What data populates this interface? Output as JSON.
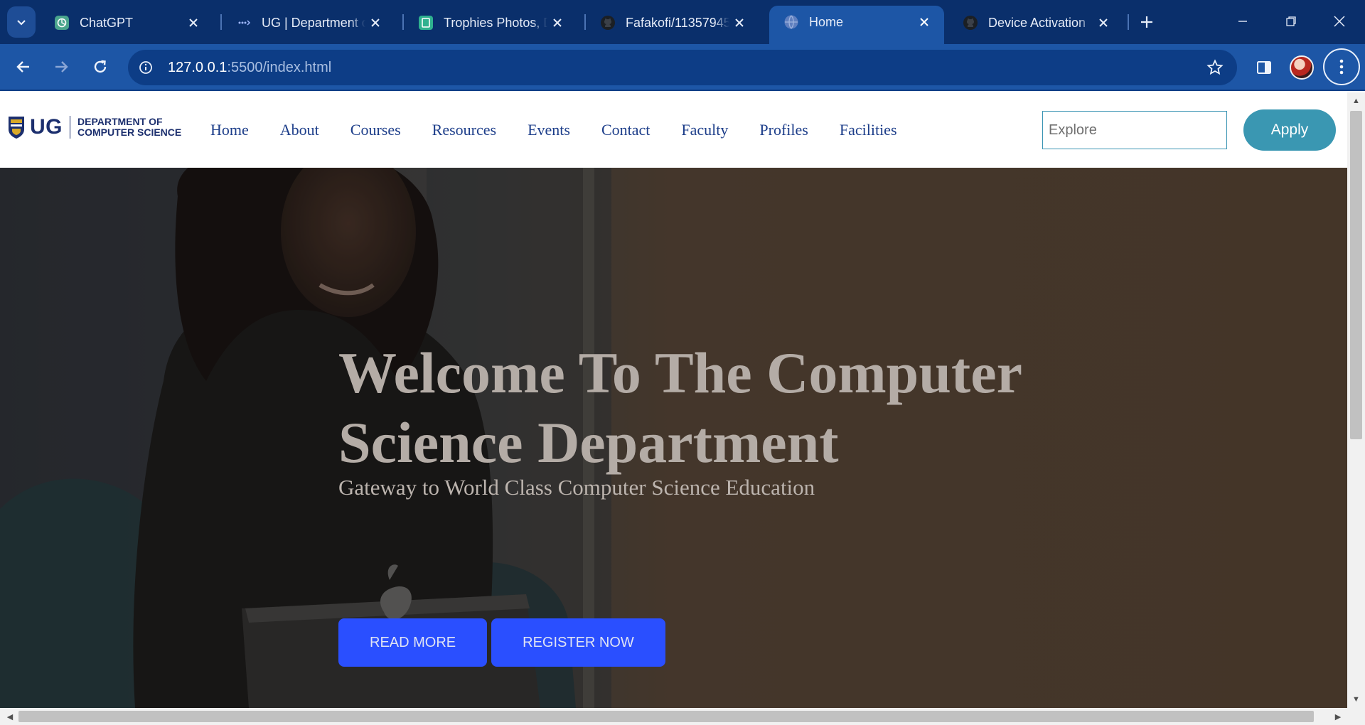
{
  "browser": {
    "tabs": [
      {
        "title": "ChatGPT",
        "icon": "chatgpt-icon",
        "active": false
      },
      {
        "title": "UG | Department of",
        "icon": "site-dots-icon",
        "active": false
      },
      {
        "title": "Trophies Photos, D",
        "icon": "photo-site-icon",
        "active": false
      },
      {
        "title": "Fafakofi/11357945",
        "icon": "github-icon",
        "active": false
      },
      {
        "title": "Home",
        "icon": "globe-icon",
        "active": true
      },
      {
        "title": "Device Activation",
        "icon": "github-icon",
        "active": false
      }
    ],
    "url_host": "127.0.0.1",
    "url_rest": ":5500/index.html"
  },
  "site": {
    "logo": {
      "short": "UG",
      "line1": "DEPARTMENT OF",
      "line2": "COMPUTER SCIENCE"
    },
    "nav": [
      "Home",
      "About",
      "Courses",
      "Resources",
      "Events",
      "Contact",
      "Faculty",
      "Profiles",
      "Facilities"
    ],
    "search_placeholder": "Explore",
    "apply_label": "Apply"
  },
  "hero": {
    "title_line1": "Welcome To The Computer",
    "title_line2": "Science Department",
    "subtitle": "Gateway to World Class Computer Science Education",
    "read_more": "READ MORE",
    "register": "REGISTER NOW"
  },
  "colors": {
    "chrome_dark": "#0a2f6b",
    "chrome_toolbar": "#1d56a6",
    "nav_link": "#1d3e8a",
    "apply_button": "#3a97b2",
    "hero_button": "#2a4fff"
  }
}
